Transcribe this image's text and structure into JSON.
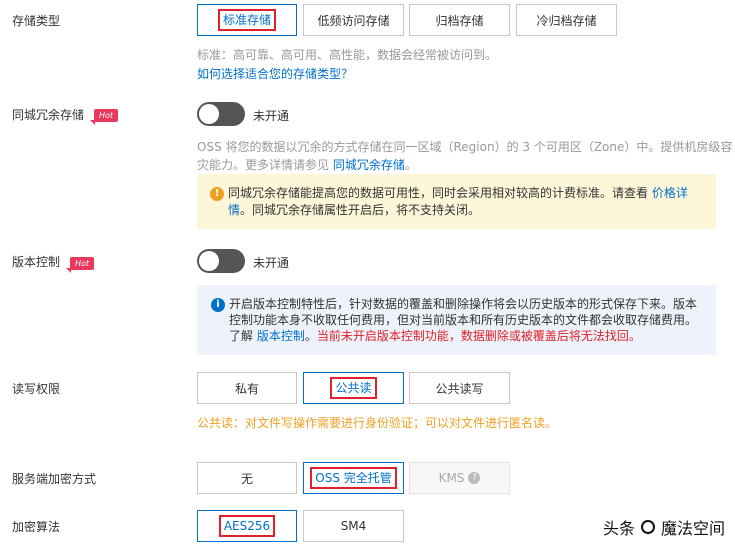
{
  "storage_class": {
    "label": "存储类型",
    "options": [
      "标准存储",
      "低频访问存储",
      "归档存储",
      "冷归档存储"
    ],
    "selected": "标准存储",
    "help": "标准：高可靠、高可用、高性能，数据会经常被访问到。",
    "link": "如何选择适合您的存储类型？"
  },
  "zone_redundancy": {
    "label": "同城冗余存储",
    "badge": "Hot",
    "toggle_state": "未开通",
    "desc_line1": "OSS 将您的数据以冗余的方式存储在同一区域（Region）的 3 个可用区（Zone）中。提供机房级容",
    "desc_line2_prefix": "灾能力。更多详情请参见 ",
    "desc_link": "同城冗余存储",
    "desc_line2_suffix": "。",
    "tip_line1_prefix": "同城冗余存储能提高您的数据可用性，同时会采用相对较高的计费标准。请查看 ",
    "tip_link_a": "价格详",
    "tip_link_b": "情",
    "tip_line2_suffix": "。同城冗余存储属性开启后，将不支持关闭。",
    "icon_glyph": "!",
    "tip_color": "#fdf6d8",
    "icon_color": "#f0a020"
  },
  "versioning": {
    "label": "版本控制",
    "badge": "Hot",
    "toggle_state": "未开通",
    "tip_line1": "开启版本控制特性后，针对数据的覆盖和删除操作将会以历史版本的形式保存下来。版本",
    "tip_line2": "控制功能本身不收取任何费用，但对当前版本和所有历史版本的文件都会收取存储费用。",
    "tip_line3_prefix": "了解 ",
    "tip_link": "版本控制",
    "tip_line3_mid": "。",
    "tip_warning": "当前未开启版本控制功能，数据删除或被覆盖后将无法找回。",
    "icon_glyph": "i",
    "tip_color": "#eef3fb",
    "icon_color": "#0070cc"
  },
  "acl": {
    "label": "读写权限",
    "options": [
      "私有",
      "公共读",
      "公共读写"
    ],
    "selected": "公共读",
    "help": "公共读：对文件写操作需要进行身份验证；可以对文件进行匿名读。"
  },
  "encryption": {
    "label": "服务端加密方式",
    "options": [
      "无",
      "OSS 完全托管",
      "KMS"
    ],
    "selected": "OSS 完全托管",
    "kms_help_glyph": "?"
  },
  "algorithm": {
    "label": "加密算法",
    "options": [
      "AES256",
      "SM4"
    ],
    "selected": "AES256"
  },
  "watermark": {
    "prefix": "头条",
    "text": "魔法空间"
  }
}
